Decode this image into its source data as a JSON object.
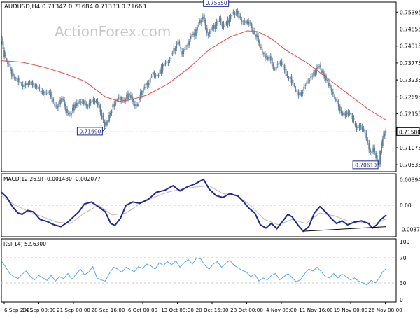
{
  "colors": {
    "candle": "#5f7f9a",
    "ma": "#e35454",
    "macd_line": "#1f2a8c",
    "macd_signal": "#b8b8b8",
    "rsi": "#5aa9e6",
    "grid": "#c8c8c8",
    "frame": "#000000",
    "watermark": "#c8c8c8",
    "label_border": "#1f2a8c"
  },
  "header": {
    "symbol": "AUDUSD,H4",
    "ohlc": "0.71342 0.71684 0.71333 0.71663",
    "watermark": "ActionForex.com"
  },
  "chart_data": [
    {
      "type": "candlestick",
      "name": "price",
      "symbol": "AUDUSD,H4",
      "ylim": [
        0.7045,
        0.7558
      ],
      "y_ticks": [
        "0.75395",
        "0.74855",
        "0.74315",
        "0.73775",
        "0.73235",
        "0.72695",
        "0.72155",
        "0.71580",
        "0.71075",
        "0.70535"
      ],
      "current_price": "0.71580",
      "annotations": [
        {
          "label": "0.75550",
          "value": 0.7555
        },
        {
          "label": "0.71690",
          "value": 0.7169
        },
        {
          "label": "0.70610",
          "value": 0.7061
        }
      ],
      "close_path": [
        [
          0,
          0.746
        ],
        [
          5,
          0.74
        ],
        [
          10,
          0.738
        ],
        [
          16,
          0.734
        ],
        [
          22,
          0.733
        ],
        [
          28,
          0.731
        ],
        [
          34,
          0.73
        ],
        [
          40,
          0.732
        ],
        [
          46,
          0.731
        ],
        [
          52,
          0.73
        ],
        [
          58,
          0.7285
        ],
        [
          64,
          0.728
        ],
        [
          70,
          0.729
        ],
        [
          76,
          0.725
        ],
        [
          82,
          0.723
        ],
        [
          88,
          0.727
        ],
        [
          94,
          0.723
        ],
        [
          100,
          0.721
        ],
        [
          106,
          0.724
        ],
        [
          112,
          0.725
        ],
        [
          118,
          0.726
        ],
        [
          124,
          0.724
        ],
        [
          130,
          0.725
        ],
        [
          136,
          0.726
        ],
        [
          142,
          0.724
        ],
        [
          146,
          0.721
        ],
        [
          150,
          0.718
        ],
        [
          155,
          0.7195
        ],
        [
          160,
          0.723
        ],
        [
          166,
          0.726
        ],
        [
          172,
          0.727
        ],
        [
          178,
          0.725
        ],
        [
          184,
          0.728
        ],
        [
          190,
          0.726
        ],
        [
          196,
          0.724
        ],
        [
          202,
          0.728
        ],
        [
          208,
          0.73
        ],
        [
          214,
          0.732
        ],
        [
          220,
          0.735
        ],
        [
          226,
          0.733
        ],
        [
          232,
          0.736
        ],
        [
          238,
          0.738
        ],
        [
          244,
          0.739
        ],
        [
          250,
          0.742
        ],
        [
          256,
          0.744
        ],
        [
          262,
          0.741
        ],
        [
          268,
          0.743
        ],
        [
          274,
          0.746
        ],
        [
          280,
          0.747
        ],
        [
          286,
          0.75
        ],
        [
          292,
          0.753
        ],
        [
          298,
          0.747
        ],
        [
          304,
          0.748
        ],
        [
          310,
          0.75
        ],
        [
          316,
          0.752
        ],
        [
          322,
          0.749
        ],
        [
          328,
          0.751
        ],
        [
          334,
          0.753
        ],
        [
          340,
          0.7545
        ],
        [
          346,
          0.752
        ],
        [
          352,
          0.75
        ],
        [
          358,
          0.751
        ],
        [
          364,
          0.748
        ],
        [
          370,
          0.746
        ],
        [
          376,
          0.742
        ],
        [
          382,
          0.739
        ],
        [
          388,
          0.74
        ],
        [
          394,
          0.736
        ],
        [
          400,
          0.737
        ],
        [
          406,
          0.738
        ],
        [
          412,
          0.734
        ],
        [
          418,
          0.733
        ],
        [
          424,
          0.73
        ],
        [
          430,
          0.727
        ],
        [
          436,
          0.729
        ],
        [
          442,
          0.732
        ],
        [
          448,
          0.733
        ],
        [
          454,
          0.735
        ],
        [
          460,
          0.737
        ],
        [
          466,
          0.734
        ],
        [
          472,
          0.732
        ],
        [
          478,
          0.728
        ],
        [
          484,
          0.726
        ],
        [
          490,
          0.723
        ],
        [
          496,
          0.721
        ],
        [
          502,
          0.722
        ],
        [
          508,
          0.72
        ],
        [
          514,
          0.717
        ],
        [
          520,
          0.718
        ],
        [
          526,
          0.715
        ],
        [
          530,
          0.712
        ],
        [
          534,
          0.709
        ],
        [
          538,
          0.711
        ],
        [
          542,
          0.708
        ],
        [
          546,
          0.7061
        ],
        [
          550,
          0.712
        ],
        [
          553,
          0.715
        ],
        [
          556,
          0.7166
        ]
      ],
      "moving_average": [
        [
          0,
          0.7385
        ],
        [
          30,
          0.738
        ],
        [
          60,
          0.7365
        ],
        [
          90,
          0.7345
        ],
        [
          120,
          0.732
        ],
        [
          150,
          0.727
        ],
        [
          170,
          0.7255
        ],
        [
          190,
          0.7262
        ],
        [
          210,
          0.7275
        ],
        [
          240,
          0.731
        ],
        [
          270,
          0.736
        ],
        [
          300,
          0.742
        ],
        [
          330,
          0.746
        ],
        [
          355,
          0.748
        ],
        [
          370,
          0.7478
        ],
        [
          390,
          0.7455
        ],
        [
          410,
          0.742
        ],
        [
          440,
          0.738
        ],
        [
          470,
          0.733
        ],
        [
          500,
          0.728
        ],
        [
          530,
          0.723
        ],
        [
          556,
          0.7195
        ]
      ]
    },
    {
      "type": "line",
      "name": "MACD(12,26,9)",
      "values_text": "-0.001480 -0.002077",
      "ylim": [
        -0.0042,
        0.0042
      ],
      "y_ticks": [
        "0.003943",
        "0.00",
        "-0.00371"
      ],
      "macd_path": [
        [
          0,
          0.002
        ],
        [
          8,
          0.0012
        ],
        [
          16,
          -0.0002
        ],
        [
          24,
          -0.0012
        ],
        [
          30,
          -0.0014
        ],
        [
          38,
          -0.0008
        ],
        [
          46,
          -0.001
        ],
        [
          56,
          -0.0022
        ],
        [
          66,
          -0.0025
        ],
        [
          76,
          -0.003
        ],
        [
          86,
          -0.0033
        ],
        [
          96,
          -0.0026
        ],
        [
          104,
          -0.0018
        ],
        [
          112,
          -0.001
        ],
        [
          120,
          0.0002
        ],
        [
          130,
          0.0005
        ],
        [
          140,
          -0.0002
        ],
        [
          150,
          -0.001
        ],
        [
          158,
          -0.0028
        ],
        [
          164,
          -0.0031
        ],
        [
          172,
          -0.002
        ],
        [
          180,
          0.0
        ],
        [
          190,
          0.0005
        ],
        [
          200,
          0.0003
        ],
        [
          212,
          0.0009
        ],
        [
          224,
          0.002
        ],
        [
          236,
          0.0023
        ],
        [
          248,
          0.003
        ],
        [
          258,
          0.0022
        ],
        [
          268,
          0.0028
        ],
        [
          280,
          0.0033
        ],
        [
          292,
          0.004
        ],
        [
          300,
          0.0025
        ],
        [
          310,
          0.0015
        ],
        [
          320,
          0.0012
        ],
        [
          330,
          0.0018
        ],
        [
          342,
          0.0014
        ],
        [
          350,
          0.0005
        ],
        [
          358,
          -0.0005
        ],
        [
          366,
          -0.0012
        ],
        [
          374,
          -0.003
        ],
        [
          382,
          -0.0035
        ],
        [
          390,
          -0.0028
        ],
        [
          398,
          -0.0036
        ],
        [
          406,
          -0.0025
        ],
        [
          414,
          -0.0014
        ],
        [
          420,
          -0.0018
        ],
        [
          428,
          -0.003
        ],
        [
          436,
          -0.004
        ],
        [
          444,
          -0.0033
        ],
        [
          452,
          -0.0012
        ],
        [
          460,
          -0.0002
        ],
        [
          468,
          -0.001
        ],
        [
          476,
          -0.002
        ],
        [
          484,
          -0.0028
        ],
        [
          492,
          -0.0024
        ],
        [
          500,
          -0.003
        ],
        [
          510,
          -0.0026
        ],
        [
          520,
          -0.0024
        ],
        [
          530,
          -0.0028
        ],
        [
          536,
          -0.0035
        ],
        [
          542,
          -0.003
        ],
        [
          548,
          -0.0022
        ],
        [
          556,
          -0.0015
        ]
      ],
      "signal_path": [
        [
          0,
          0.0015
        ],
        [
          20,
          0.0
        ],
        [
          40,
          -0.001
        ],
        [
          60,
          -0.0018
        ],
        [
          80,
          -0.0026
        ],
        [
          100,
          -0.0028
        ],
        [
          120,
          -0.0012
        ],
        [
          140,
          0.0
        ],
        [
          160,
          -0.0015
        ],
        [
          180,
          -0.0012
        ],
        [
          200,
          0.0002
        ],
        [
          220,
          0.0012
        ],
        [
          240,
          0.002
        ],
        [
          260,
          0.0025
        ],
        [
          280,
          0.0028
        ],
        [
          300,
          0.003
        ],
        [
          320,
          0.0018
        ],
        [
          340,
          0.0015
        ],
        [
          360,
          0.0
        ],
        [
          380,
          -0.0022
        ],
        [
          400,
          -0.003
        ],
        [
          420,
          -0.0022
        ],
        [
          440,
          -0.0028
        ],
        [
          460,
          -0.0012
        ],
        [
          480,
          -0.0016
        ],
        [
          500,
          -0.0024
        ],
        [
          520,
          -0.0026
        ],
        [
          540,
          -0.0028
        ],
        [
          556,
          -0.0021
        ]
      ],
      "trendline": [
        [
          436,
          -0.004
        ],
        [
          556,
          -0.0033
        ]
      ]
    },
    {
      "type": "line",
      "name": "RSI(14)",
      "value_text": "52.6300",
      "ylim": [
        0,
        100
      ],
      "y_ticks": [
        "100",
        "70",
        "30",
        "0"
      ],
      "levels": [
        70,
        30
      ],
      "rsi_path": [
        [
          0,
          65
        ],
        [
          6,
          56
        ],
        [
          12,
          45
        ],
        [
          18,
          40
        ],
        [
          24,
          37
        ],
        [
          30,
          44
        ],
        [
          36,
          49
        ],
        [
          42,
          40
        ],
        [
          48,
          35
        ],
        [
          54,
          42
        ],
        [
          60,
          38
        ],
        [
          66,
          34
        ],
        [
          72,
          42
        ],
        [
          78,
          33
        ],
        [
          84,
          40
        ],
        [
          90,
          37
        ],
        [
          96,
          45
        ],
        [
          102,
          36
        ],
        [
          108,
          44
        ],
        [
          114,
          52
        ],
        [
          120,
          43
        ],
        [
          126,
          47
        ],
        [
          132,
          56
        ],
        [
          138,
          38
        ],
        [
          144,
          35
        ],
        [
          150,
          33
        ],
        [
          156,
          45
        ],
        [
          162,
          55
        ],
        [
          168,
          52
        ],
        [
          174,
          47
        ],
        [
          180,
          55
        ],
        [
          186,
          51
        ],
        [
          192,
          48
        ],
        [
          198,
          56
        ],
        [
          204,
          53
        ],
        [
          210,
          60
        ],
        [
          216,
          57
        ],
        [
          222,
          52
        ],
        [
          228,
          62
        ],
        [
          234,
          58
        ],
        [
          240,
          64
        ],
        [
          246,
          59
        ],
        [
          252,
          65
        ],
        [
          258,
          55
        ],
        [
          264,
          62
        ],
        [
          270,
          67
        ],
        [
          276,
          60
        ],
        [
          282,
          70
        ],
        [
          288,
          68
        ],
        [
          294,
          58
        ],
        [
          300,
          52
        ],
        [
          306,
          60
        ],
        [
          312,
          64
        ],
        [
          318,
          55
        ],
        [
          324,
          61
        ],
        [
          330,
          66
        ],
        [
          336,
          58
        ],
        [
          342,
          54
        ],
        [
          348,
          50
        ],
        [
          354,
          47
        ],
        [
          360,
          40
        ],
        [
          366,
          44
        ],
        [
          372,
          33
        ],
        [
          378,
          38
        ],
        [
          384,
          35
        ],
        [
          390,
          42
        ],
        [
          396,
          45
        ],
        [
          402,
          35
        ],
        [
          408,
          40
        ],
        [
          414,
          45
        ],
        [
          420,
          38
        ],
        [
          426,
          32
        ],
        [
          432,
          35
        ],
        [
          438,
          45
        ],
        [
          444,
          52
        ],
        [
          450,
          49
        ],
        [
          456,
          55
        ],
        [
          462,
          48
        ],
        [
          468,
          40
        ],
        [
          474,
          38
        ],
        [
          480,
          45
        ],
        [
          486,
          38
        ],
        [
          492,
          44
        ],
        [
          498,
          40
        ],
        [
          504,
          35
        ],
        [
          510,
          38
        ],
        [
          516,
          33
        ],
        [
          522,
          30
        ],
        [
          528,
          27
        ],
        [
          534,
          34
        ],
        [
          540,
          30
        ],
        [
          546,
          38
        ],
        [
          550,
          47
        ],
        [
          556,
          53
        ]
      ]
    }
  ],
  "x_axis": {
    "labels": [
      {
        "label": "6 Sep 2021",
        "x": 0
      },
      {
        "label": "14 Sep 00:00",
        "x": 62
      },
      {
        "label": "21 Sep 08:00",
        "x": 132
      },
      {
        "label": "28 Sep 16:00",
        "x": 195
      },
      {
        "label": "6 Oct 00:00",
        "x": 257
      },
      {
        "label": "13 Oct 08:00",
        "x": 322
      },
      {
        "label": "20 Oct 16:00",
        "x": 382
      },
      {
        "label": "28 Oct 00:00",
        "x": 447
      },
      {
        "label": "4 Nov 08:00",
        "x": 512
      },
      {
        "label": "11 Nov 16:00",
        "x": 573
      },
      {
        "label": "19 Nov 00:00",
        "x": 638
      },
      {
        "label": "26 Nov 08:00",
        "x": 699
      }
    ]
  }
}
